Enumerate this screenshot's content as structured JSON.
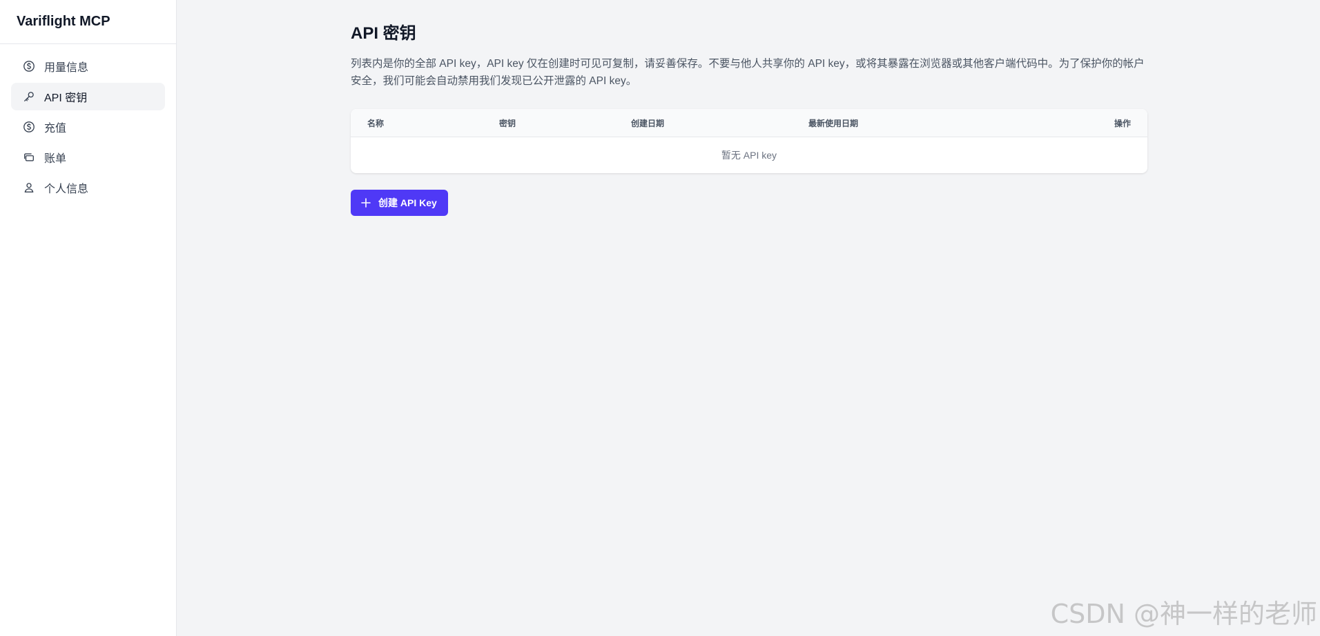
{
  "app": {
    "brand": "Variflight MCP"
  },
  "sidebar": {
    "items": [
      {
        "label": "用量信息",
        "icon": "dollar-circle-icon",
        "active": false
      },
      {
        "label": "API 密钥",
        "icon": "key-icon",
        "active": true
      },
      {
        "label": "充值",
        "icon": "dollar-circle-icon",
        "active": false
      },
      {
        "label": "账单",
        "icon": "cards-icon",
        "active": false
      },
      {
        "label": "个人信息",
        "icon": "user-icon",
        "active": false
      }
    ]
  },
  "main": {
    "title": "API 密钥",
    "description": "列表内是你的全部 API key，API key 仅在创建时可见可复制，请妥善保存。不要与他人共享你的 API key，或将其暴露在浏览器或其他客户端代码中。为了保护你的帐户安全，我们可能会自动禁用我们发现已公开泄露的 API key。",
    "table": {
      "columns": [
        "名称",
        "密钥",
        "创建日期",
        "最新使用日期",
        "操作"
      ],
      "empty_text": "暂无 API key"
    },
    "create_button": "创建 API Key"
  },
  "watermark": "CSDN @神一样的老师",
  "colors": {
    "accent": "#4f39f6",
    "background": "#f3f4f6",
    "sidebar_bg": "#ffffff",
    "active_item_bg": "#f3f4f6"
  }
}
